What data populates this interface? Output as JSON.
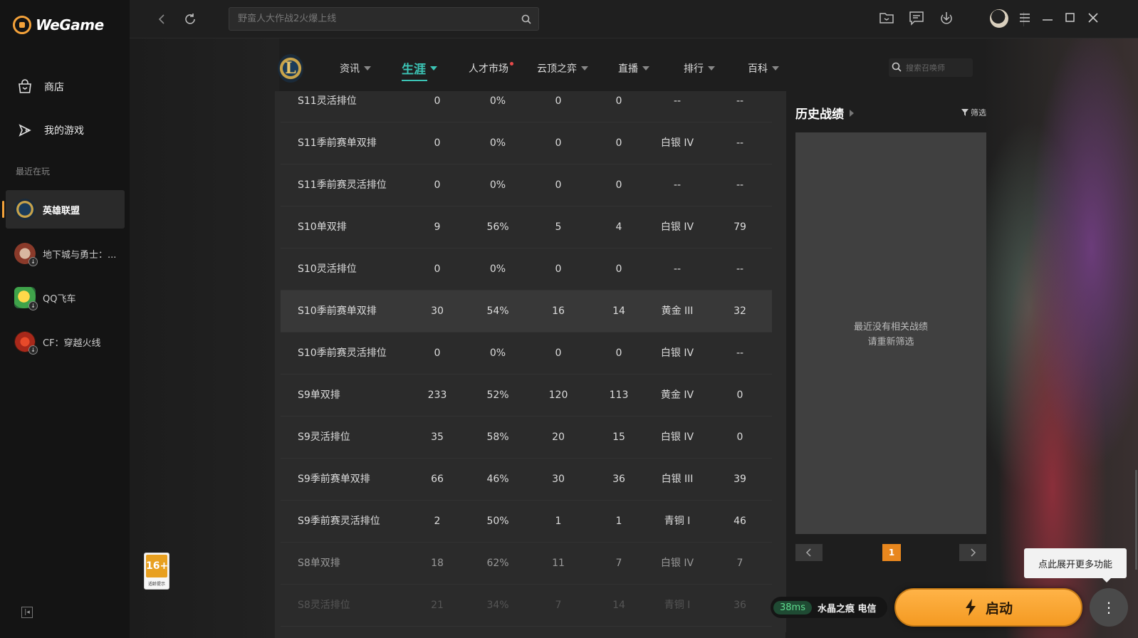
{
  "app": {
    "name": "WeGame"
  },
  "sidebar": {
    "nav": [
      {
        "label": "商店",
        "icon": "store-bag-icon"
      },
      {
        "label": "我的游戏",
        "icon": "gamepad-icon"
      }
    ],
    "recent_label": "最近在玩",
    "games": [
      {
        "label": "英雄联盟",
        "active": true
      },
      {
        "label": "地下城与勇士：...",
        "active": false
      },
      {
        "label": "QQ飞车",
        "active": false
      },
      {
        "label": "CF：穿越火线",
        "active": false
      }
    ]
  },
  "topbar": {
    "search_placeholder": "野蛮人大作战2火爆上线"
  },
  "game_nav": {
    "logo_letter": "L",
    "tabs": [
      {
        "label": "资讯",
        "caret": true,
        "active": false
      },
      {
        "label": "生涯",
        "caret": true,
        "active": true
      },
      {
        "label": "人才市场",
        "caret": false,
        "active": false,
        "dot": true
      },
      {
        "label": "云顶之弈",
        "caret": true,
        "active": false
      },
      {
        "label": "直播",
        "caret": true,
        "active": false
      },
      {
        "label": "排行",
        "caret": true,
        "active": false
      },
      {
        "label": "百科",
        "caret": true,
        "active": false
      }
    ],
    "summoner_search_placeholder": "搜索召唤师"
  },
  "stats_table": {
    "rows": [
      [
        "S11灵活排位",
        "0",
        "0%",
        "0",
        "0",
        "--",
        "--"
      ],
      [
        "S11季前赛单双排",
        "0",
        "0%",
        "0",
        "0",
        "白银 IV",
        "--"
      ],
      [
        "S11季前赛灵活排位",
        "0",
        "0%",
        "0",
        "0",
        "--",
        "--"
      ],
      [
        "S10单双排",
        "9",
        "56%",
        "5",
        "4",
        "白银 IV",
        "79"
      ],
      [
        "S10灵活排位",
        "0",
        "0%",
        "0",
        "0",
        "--",
        "--"
      ],
      [
        "S10季前赛单双排",
        "30",
        "54%",
        "16",
        "14",
        "黄金 III",
        "32"
      ],
      [
        "S10季前赛灵活排位",
        "0",
        "0%",
        "0",
        "0",
        "白银 IV",
        "--"
      ],
      [
        "S9单双排",
        "233",
        "52%",
        "120",
        "113",
        "黄金 IV",
        "0"
      ],
      [
        "S9灵活排位",
        "35",
        "58%",
        "20",
        "15",
        "白银 IV",
        "0"
      ],
      [
        "S9季前赛单双排",
        "66",
        "46%",
        "30",
        "36",
        "白银 III",
        "39"
      ],
      [
        "S9季前赛灵活排位",
        "2",
        "50%",
        "1",
        "1",
        "青铜 I",
        "46"
      ],
      [
        "S8单双排",
        "18",
        "62%",
        "11",
        "7",
        "白银 IV",
        "7"
      ],
      [
        "S8灵活排位",
        "21",
        "34%",
        "7",
        "14",
        "青铜 I",
        "36"
      ]
    ]
  },
  "history": {
    "title": "历史战绩",
    "filter_label": "筛选",
    "empty_line1": "最近没有相关战绩",
    "empty_line2": "请重新筛选",
    "page": "1"
  },
  "age_rating": {
    "label": "16+",
    "sub": "适龄提示"
  },
  "launch": {
    "ping": "38ms",
    "server": "水晶之痕 电信",
    "button_label": "启动",
    "tooltip": "点此展开更多功能"
  },
  "colors": {
    "accent": "#3cc5b6",
    "launch": "#f4a23a"
  }
}
